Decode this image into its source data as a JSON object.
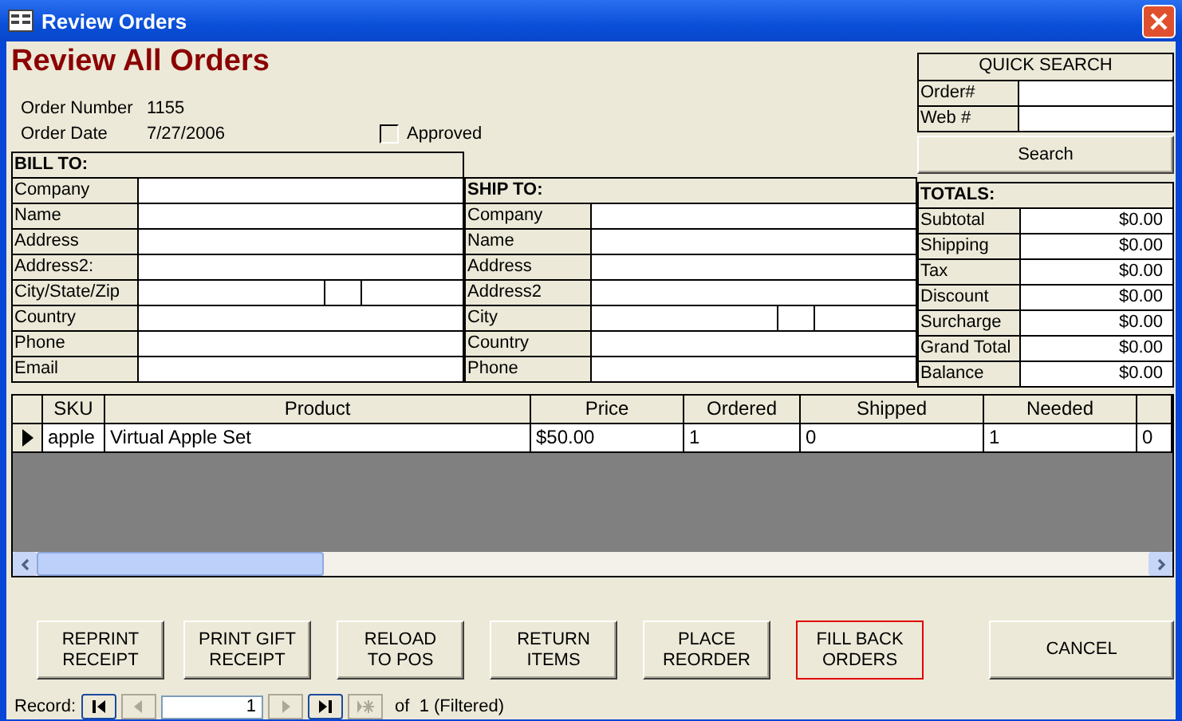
{
  "window": {
    "title": "Review Orders"
  },
  "heading": "Review All Orders",
  "order_info": [
    {
      "label": "Order Number",
      "value": "1155"
    },
    {
      "label": "Order Date",
      "value": "7/27/2006"
    }
  ],
  "approved": {
    "label": "Approved",
    "checked": false
  },
  "quick_search": {
    "title": "QUICK SEARCH",
    "fields": [
      {
        "label": "Order#"
      },
      {
        "label": "Web #"
      }
    ],
    "button": "Search"
  },
  "bill_to": {
    "title": "BILL TO:",
    "rows": [
      {
        "label": "Company",
        "kind": "single"
      },
      {
        "label": "Name",
        "kind": "single"
      },
      {
        "label": "Address",
        "kind": "single"
      },
      {
        "label": "Address2:",
        "kind": "single"
      },
      {
        "label": "City/State/Zip",
        "kind": "split"
      },
      {
        "label": "Country",
        "kind": "single"
      },
      {
        "label": "Phone",
        "kind": "single"
      },
      {
        "label": "Email",
        "kind": "single"
      }
    ]
  },
  "ship_to": {
    "title": "SHIP TO:",
    "rows": [
      {
        "label": "Company",
        "kind": "single"
      },
      {
        "label": "Name",
        "kind": "single"
      },
      {
        "label": "Address",
        "kind": "single"
      },
      {
        "label": "Address2",
        "kind": "single"
      },
      {
        "label": "City",
        "kind": "split"
      },
      {
        "label": "Country",
        "kind": "single"
      },
      {
        "label": "Phone",
        "kind": "single"
      }
    ]
  },
  "totals": {
    "title": "TOTALS:",
    "rows": [
      {
        "label": "Subtotal",
        "value": "$0.00"
      },
      {
        "label": "Shipping",
        "value": "$0.00"
      },
      {
        "label": "Tax",
        "value": "$0.00"
      },
      {
        "label": "Discount",
        "value": "$0.00"
      },
      {
        "label": "Surcharge",
        "value": "$0.00"
      },
      {
        "label": "Grand Total",
        "value": "$0.00"
      },
      {
        "label": "Balance",
        "value": "$0.00"
      }
    ]
  },
  "grid": {
    "columns": [
      "SKU",
      "Product",
      "Price",
      "Ordered",
      "Shipped",
      "Needed"
    ],
    "rows": [
      {
        "current": true,
        "cells": [
          "apple",
          "Virtual Apple Set",
          "$50.00",
          "1",
          "0",
          "1",
          "0"
        ]
      }
    ]
  },
  "buttons": [
    {
      "lines": [
        "REPRINT",
        "RECEIPT"
      ],
      "selected": false
    },
    {
      "lines": [
        "PRINT GIFT",
        "RECEIPT"
      ],
      "selected": false
    },
    {
      "lines": [
        "RELOAD",
        "TO POS"
      ],
      "selected": false
    },
    {
      "lines": [
        "RETURN",
        "ITEMS"
      ],
      "selected": false
    },
    {
      "lines": [
        "PLACE",
        "REORDER"
      ],
      "selected": false
    },
    {
      "lines": [
        "FILL BACK",
        "ORDERS"
      ],
      "selected": true
    }
  ],
  "cancel_button": "CANCEL",
  "record_nav": {
    "label": "Record:",
    "current": "1",
    "total": "of  1 (Filtered)",
    "buttons": [
      {
        "kind": "first",
        "disabled": false
      },
      {
        "kind": "prev",
        "disabled": true
      },
      {
        "kind": "next",
        "disabled": true
      },
      {
        "kind": "last",
        "disabled": false
      },
      {
        "kind": "new",
        "disabled": true
      }
    ]
  }
}
